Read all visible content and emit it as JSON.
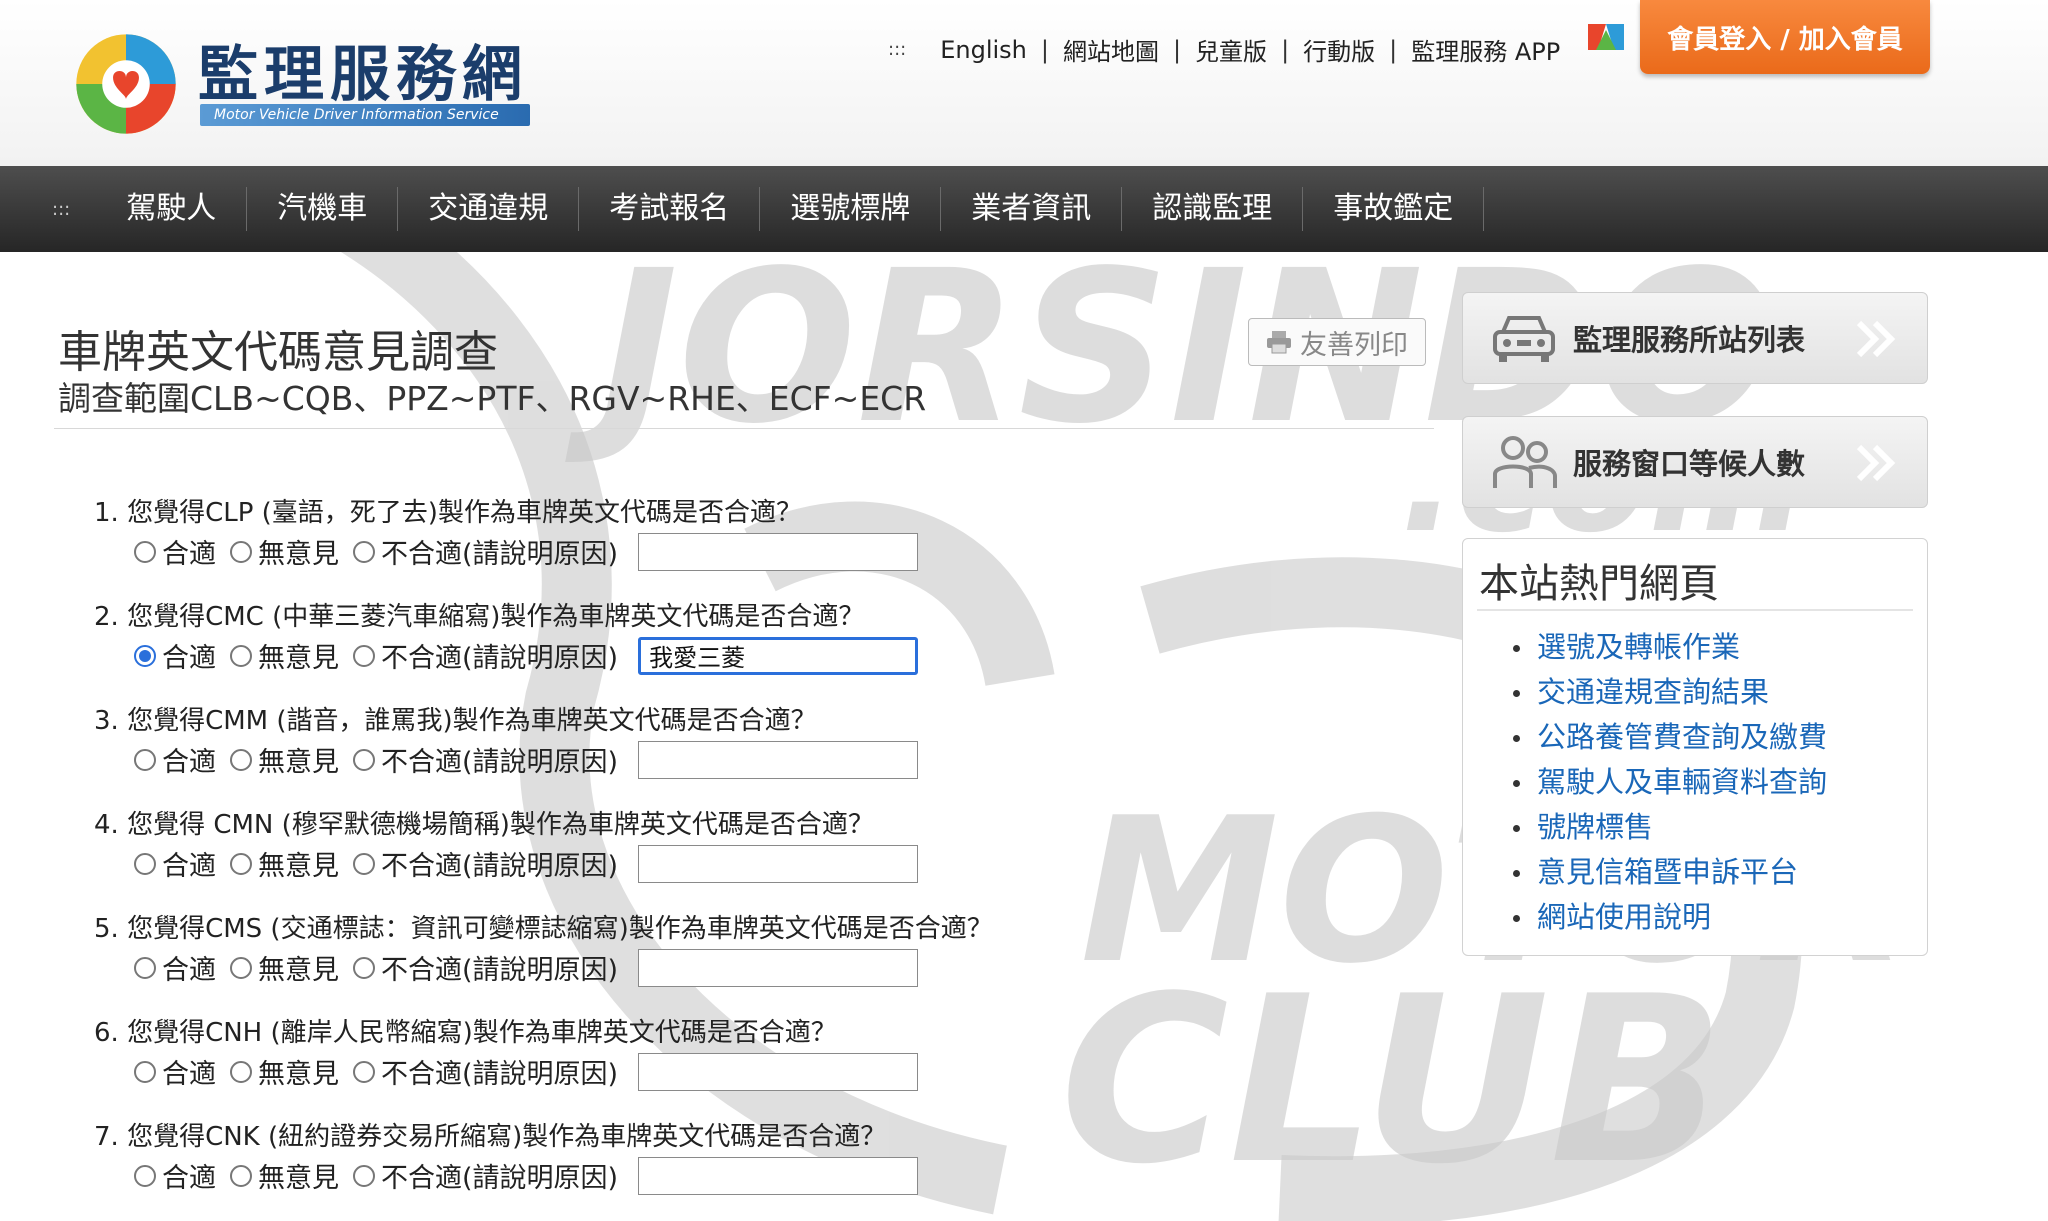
{
  "header": {
    "site_title": "監理服務網",
    "site_subtitle": "Motor Vehicle Driver Information Service",
    "top_links": [
      "English",
      "網站地圖",
      "兒童版",
      "行動版",
      "監理服務 APP"
    ],
    "menu_dots": ":::",
    "login_button": "會員登入 / 加入會員"
  },
  "nav": {
    "dots": ":::",
    "items": [
      "駕駛人",
      "汽機車",
      "交通違規",
      "考試報名",
      "選號標牌",
      "業者資訊",
      "認識監理",
      "事故鑑定"
    ]
  },
  "page": {
    "title": "車牌英文代碼意見調查",
    "subtitle": "調查範圍CLB~CQB、PPZ~PTF、RGV~RHE、ECF~ECR",
    "print_label": "友善列印"
  },
  "options": {
    "agree": "合適",
    "neutral": "無意見",
    "disagree": "不合適(請說明原因)"
  },
  "questions": [
    {
      "text": "1. 您覺得CLP (臺語，死了去)製作為車牌英文代碼是否合適？",
      "selected": "",
      "reason": ""
    },
    {
      "text": "2. 您覺得CMC (中華三菱汽車縮寫)製作為車牌英文代碼是否合適？",
      "selected": "agree",
      "reason": "我愛三菱"
    },
    {
      "text": "3. 您覺得CMM (諧音，誰罵我)製作為車牌英文代碼是否合適？",
      "selected": "",
      "reason": ""
    },
    {
      "text": "4. 您覺得 CMN (穆罕默德機場簡稱)製作為車牌英文代碼是否合適？",
      "selected": "",
      "reason": ""
    },
    {
      "text": "5. 您覺得CMS (交通標誌：資訊可變標誌縮寫)製作為車牌英文代碼是否合適？",
      "selected": "",
      "reason": ""
    },
    {
      "text": "6. 您覺得CNH (離岸人民幣縮寫)製作為車牌英文代碼是否合適？",
      "selected": "",
      "reason": ""
    },
    {
      "text": "7. 您覺得CNK (紐約證券交易所縮寫)製作為車牌英文代碼是否合適？",
      "selected": "",
      "reason": ""
    }
  ],
  "sidebar": {
    "station_list": "監理服務所站列表",
    "waiting_count": "服務窗口等候人數",
    "hot_title": "本站熱門網頁",
    "hot_links": [
      "選號及轉帳作業",
      "交通違規查詢結果",
      "公路養管費查詢及繳費",
      "駕駛人及車輛資料查詢",
      "號牌標售",
      "意見信箱暨申訴平台",
      "網站使用說明"
    ]
  },
  "watermark": {
    "line1": "JORSINDO",
    "line2": ".com",
    "line3": "MOTOR",
    "line4": "CLUB"
  },
  "colors": {
    "accent_orange": "#f07a2a",
    "nav_dark": "#333333",
    "link_blue": "#1a67b8",
    "focus_blue": "#2a6fdb"
  }
}
